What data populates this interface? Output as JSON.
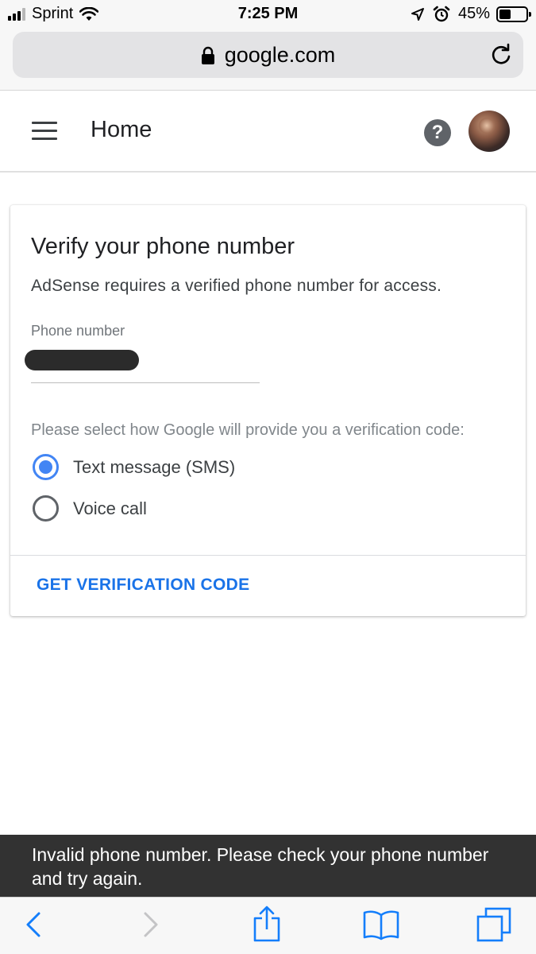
{
  "status_bar": {
    "carrier": "Sprint",
    "time": "7:25 PM",
    "battery": "45%",
    "battery_level": 0.45,
    "icons": [
      "signal-icon",
      "wifi-icon",
      "location-icon",
      "alarm-icon",
      "battery-icon"
    ]
  },
  "browser": {
    "url": "google.com",
    "icons": [
      "lock-icon",
      "reload-icon"
    ]
  },
  "app_bar": {
    "title": "Home",
    "help_label": "?",
    "icons": [
      "menu-icon",
      "help-icon",
      "avatar"
    ]
  },
  "card": {
    "title": "Verify your phone number",
    "description": "AdSense requires a verified phone number for access.",
    "phone_label": "Phone number",
    "prompt": "Please select how Google will provide you a verification code:",
    "options": [
      {
        "label": "Text message (SMS)",
        "selected": true
      },
      {
        "label": "Voice call",
        "selected": false
      }
    ],
    "action": "GET VERIFICATION CODE"
  },
  "snackbar": {
    "message": "Invalid phone number. Please check your phone number and try again."
  },
  "toolbar": {
    "icons": [
      "back-icon",
      "forward-icon",
      "share-icon",
      "bookmarks-icon",
      "tabs-icon"
    ]
  },
  "colors": {
    "accent": "#4285f4",
    "link": "#1a73e8",
    "snackbar_bg": "#323232",
    "ios_blue": "#147efb"
  }
}
